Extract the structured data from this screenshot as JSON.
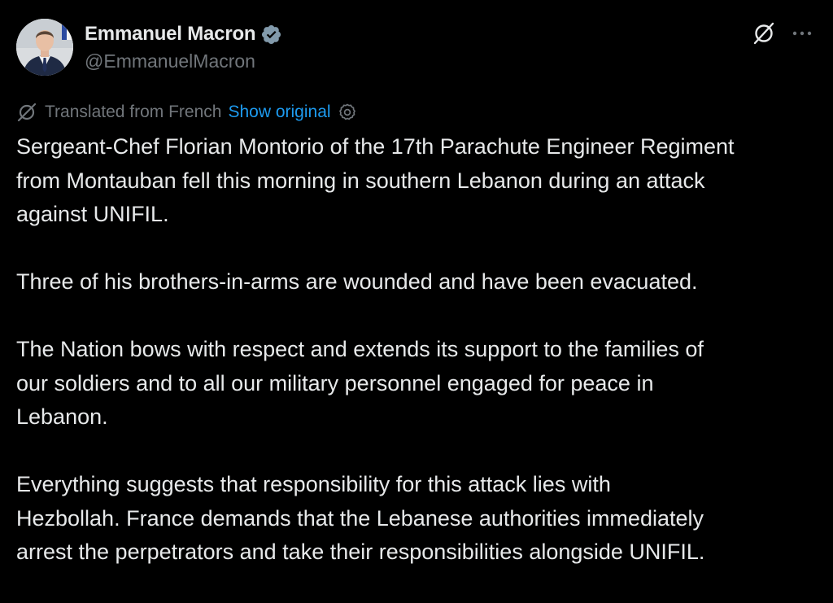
{
  "author": {
    "display_name": "Emmanuel Macron",
    "handle": "@EmmanuelMacron",
    "verified": true,
    "avatar_icon": "profile-photo"
  },
  "header_actions": {
    "grok_icon": "grok-icon",
    "more_icon": "more-icon"
  },
  "translation": {
    "label": "Translated from French",
    "show_original": "Show original",
    "icon": "translate-icon",
    "settings_icon": "gear-icon"
  },
  "tweet": {
    "paragraphs": [
      "Sergeant-Chef Florian Montorio of the 17th Parachute Engineer Regiment\nfrom Montauban fell this morning in southern Lebanon during an attack\nagainst UNIFIL.",
      "Three of his brothers-in-arms are wounded and have been evacuated.",
      "The Nation bows with respect and extends its support to the families of\nour soldiers and to all our military personnel engaged for peace in\nLebanon.",
      "Everything suggests that responsibility for this attack lies with\nHezbollah. France demands that the Lebanese authorities immediately\narrest the perpetrators and take their responsibilities alongside UNIFIL."
    ]
  },
  "colors": {
    "background": "#000000",
    "text_primary": "#e7e9ea",
    "text_secondary": "#71767b",
    "link": "#1d9bf0",
    "verified_badge": "#829aab"
  }
}
